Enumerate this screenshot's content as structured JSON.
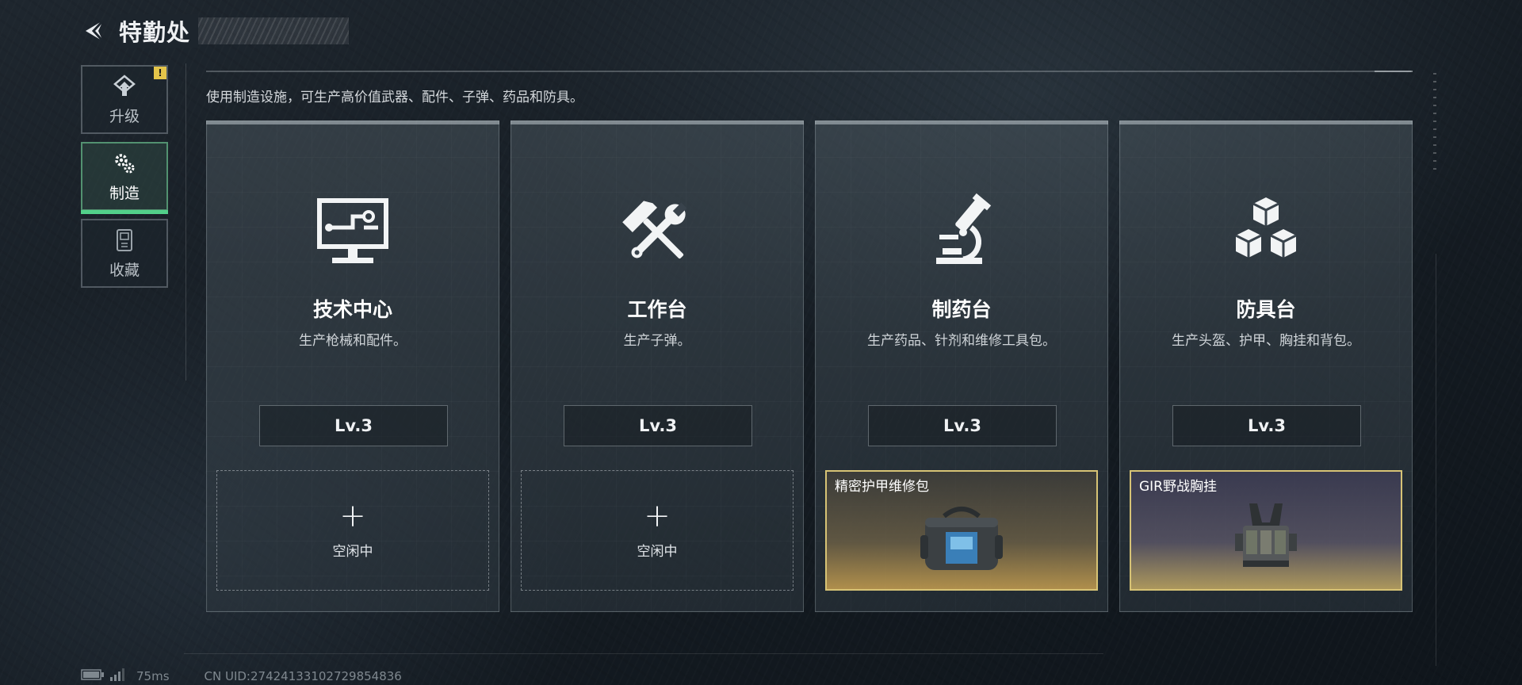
{
  "header": {
    "title": "特勤处"
  },
  "sidebar": {
    "tabs": [
      {
        "label": "升级",
        "icon": "upgrade-icon",
        "active": false,
        "alert": "!"
      },
      {
        "label": "制造",
        "icon": "gears-icon",
        "active": true
      },
      {
        "label": "收藏",
        "icon": "collection-icon",
        "active": false
      }
    ]
  },
  "main": {
    "description": "使用制造设施，可生产高价值武器、配件、子弹、药品和防具。",
    "stations": [
      {
        "name": "技术中心",
        "desc": "生产枪械和配件。",
        "level": "Lv.3",
        "icon": "computer-icon",
        "slot": {
          "state": "idle",
          "plus": "+",
          "label": "空闲中"
        }
      },
      {
        "name": "工作台",
        "desc": "生产子弹。",
        "level": "Lv.3",
        "icon": "hammer-wrench-icon",
        "slot": {
          "state": "idle",
          "plus": "+",
          "label": "空闲中"
        }
      },
      {
        "name": "制药台",
        "desc": "生产药品、针剂和维修工具包。",
        "level": "Lv.3",
        "icon": "microscope-icon",
        "slot": {
          "state": "item",
          "label": "精密护甲维修包",
          "icon": "repair-kit-bag-icon"
        }
      },
      {
        "name": "防具台",
        "desc": "生产头盔、护甲、胸挂和背包。",
        "level": "Lv.3",
        "icon": "armor-boxes-icon",
        "slot": {
          "state": "item",
          "label": "GIR野战胸挂",
          "icon": "chest-rig-icon"
        }
      }
    ]
  },
  "status": {
    "ping": "75ms",
    "uid": "CN UID:27424133102729854836"
  },
  "colors": {
    "accent_green": "#52d08a",
    "alert_yellow": "#e4c54a",
    "item_border_gold": "#d7c375"
  }
}
